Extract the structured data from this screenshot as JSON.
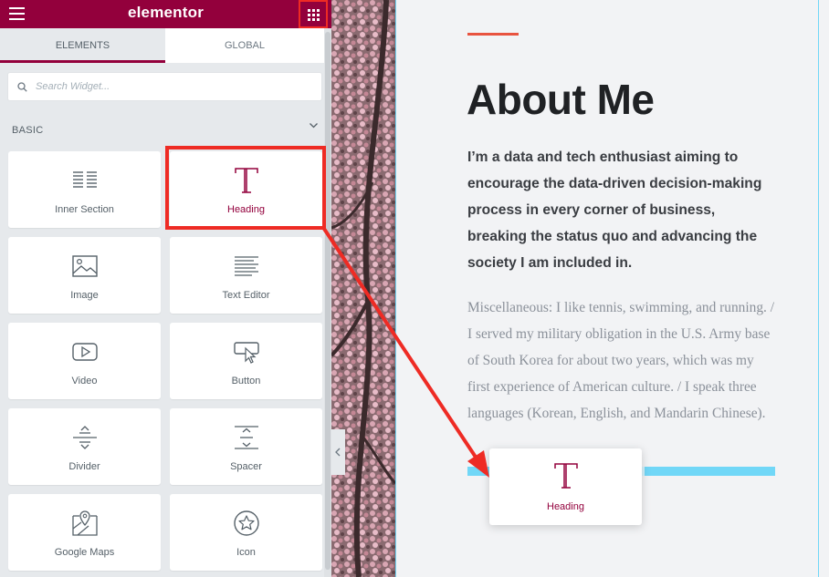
{
  "header": {
    "brand": "elementor"
  },
  "tabs": [
    {
      "label": "ELEMENTS",
      "active": true
    },
    {
      "label": "GLOBAL",
      "active": false
    }
  ],
  "search": {
    "placeholder": "Search Widget..."
  },
  "category": {
    "label": "BASIC",
    "expanded": true
  },
  "widgets": [
    {
      "label": "Inner Section",
      "icon": "inner-section-icon"
    },
    {
      "label": "Heading",
      "icon": "heading-icon",
      "highlighted": true
    },
    {
      "label": "Image",
      "icon": "image-icon"
    },
    {
      "label": "Text Editor",
      "icon": "text-editor-icon"
    },
    {
      "label": "Video",
      "icon": "video-icon"
    },
    {
      "label": "Button",
      "icon": "button-icon"
    },
    {
      "label": "Divider",
      "icon": "divider-icon"
    },
    {
      "label": "Spacer",
      "icon": "spacer-icon"
    },
    {
      "label": "Google Maps",
      "icon": "map-pin-icon"
    },
    {
      "label": "Icon",
      "icon": "star-icon"
    }
  ],
  "preview": {
    "title": "About Me",
    "bio": "I’m a data and tech enthusiast aiming to encourage the data-driven decision-making process in every corner of business, breaking the status quo and advancing the society I am included in.",
    "misc": "Miscellaneous: I like tennis, swimming, and running. / I served my military obligation in the U.S. Army base of South Korea for about two years, which was my first experience of American culture. / I speak three languages (Korean, English, and Mandarin Chinese)."
  },
  "drag_ghost": {
    "label": "Heading",
    "icon": "heading-icon"
  },
  "colors": {
    "brand": "#93003c",
    "annotation": "#ee2b24",
    "drop_indicator": "#71d7f7",
    "accent": "#e8533f"
  }
}
